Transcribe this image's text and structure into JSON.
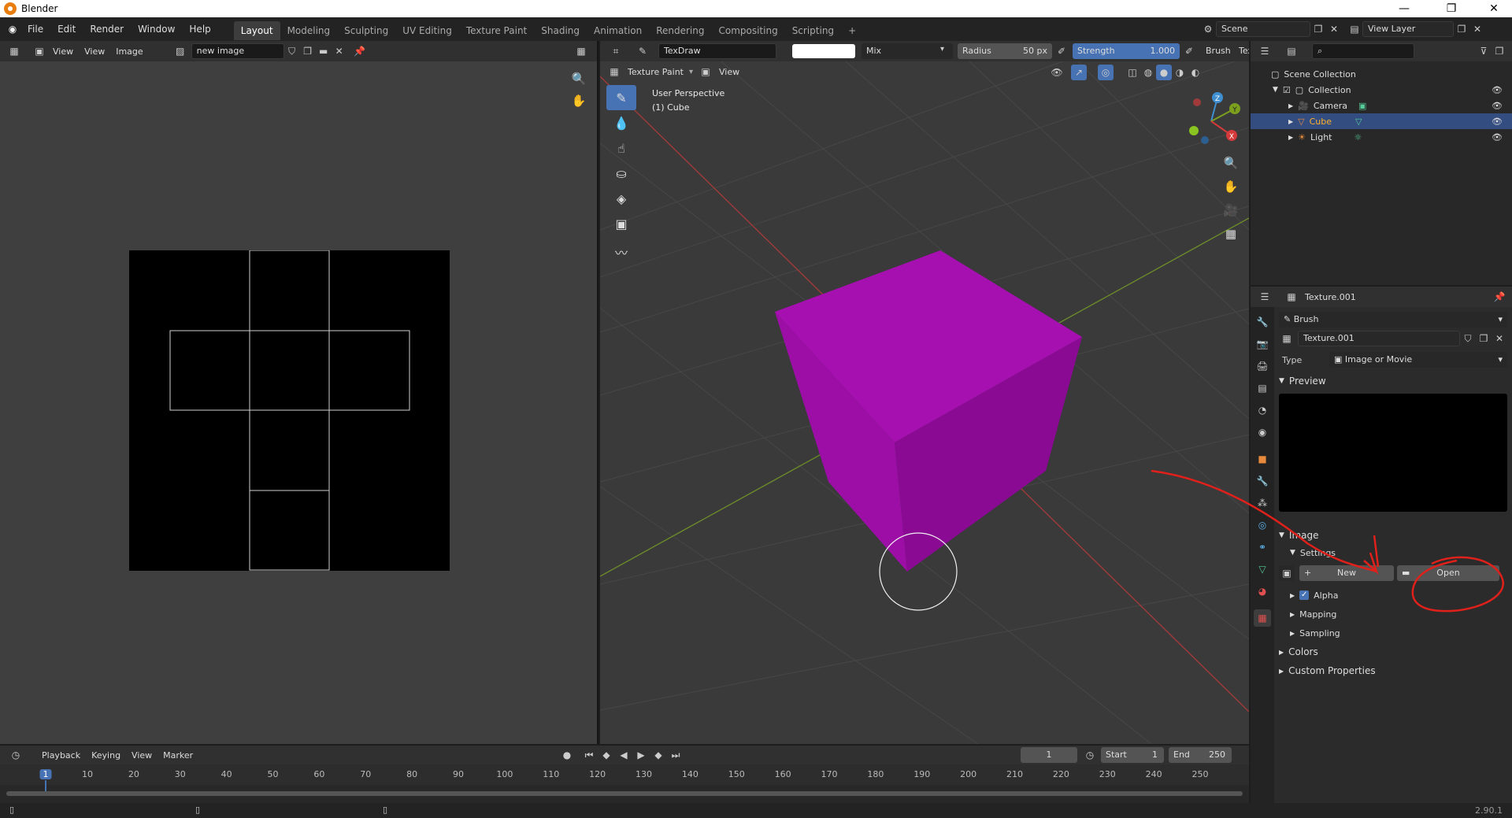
{
  "window": {
    "title": "Blender",
    "min": "—",
    "max": "❐",
    "close": "✕"
  },
  "menus": [
    "File",
    "Edit",
    "Render",
    "Window",
    "Help"
  ],
  "workspaces": [
    "Layout",
    "Modeling",
    "Sculpting",
    "UV Editing",
    "Texture Paint",
    "Shading",
    "Animation",
    "Rendering",
    "Compositing",
    "Scripting"
  ],
  "add_workspace": "+",
  "scene": {
    "label": "Scene",
    "view_layer": "View Layer"
  },
  "image_editor": {
    "menus": [
      "View",
      "View",
      "Image"
    ],
    "image_name": "new image"
  },
  "viewport": {
    "brush_name": "TexDraw",
    "blend": "Mix",
    "radius_label": "Radius",
    "radius_value": "50 px",
    "strength_label": "Strength",
    "strength_value": "1.000",
    "brush_menu": "Brush",
    "tex_menu": "Tex",
    "mode": "Texture Paint",
    "view_menu": "View",
    "overlay_title": "User Perspective",
    "overlay_object": "(1) Cube",
    "cube_color": "#a60fb0",
    "gizmo": {
      "z": "Z",
      "y": "Y",
      "x": "X"
    }
  },
  "outliner": {
    "root": "Scene Collection",
    "collection": "Collection",
    "items": [
      "Camera",
      "Cube",
      "Light"
    ],
    "selected_color": "#334d80"
  },
  "properties": {
    "texture_name": "Texture.001",
    "context": "Brush",
    "texture_field": "Texture.001",
    "type_label": "Type",
    "type_value": "Image or Movie",
    "preview": "Preview",
    "image": "Image",
    "settings": "Settings",
    "new_btn": "New",
    "open_btn": "Open",
    "alpha": "Alpha",
    "mapping": "Mapping",
    "sampling": "Sampling",
    "colors": "Colors",
    "custom": "Custom Properties"
  },
  "timeline": {
    "menus": [
      "Playback",
      "Keying",
      "View",
      "Marker"
    ],
    "current_frame": "1",
    "start_label": "Start",
    "start_value": "1",
    "end_label": "End",
    "end_value": "250",
    "ticks": [
      "1",
      "10",
      "20",
      "30",
      "40",
      "50",
      "60",
      "70",
      "80",
      "90",
      "100",
      "110",
      "120",
      "130",
      "140",
      "150",
      "160",
      "170",
      "180",
      "190",
      "200",
      "210",
      "220",
      "230",
      "240",
      "250"
    ]
  },
  "status": {
    "version": "2.90.1"
  },
  "annotation_color": "#e0201a"
}
